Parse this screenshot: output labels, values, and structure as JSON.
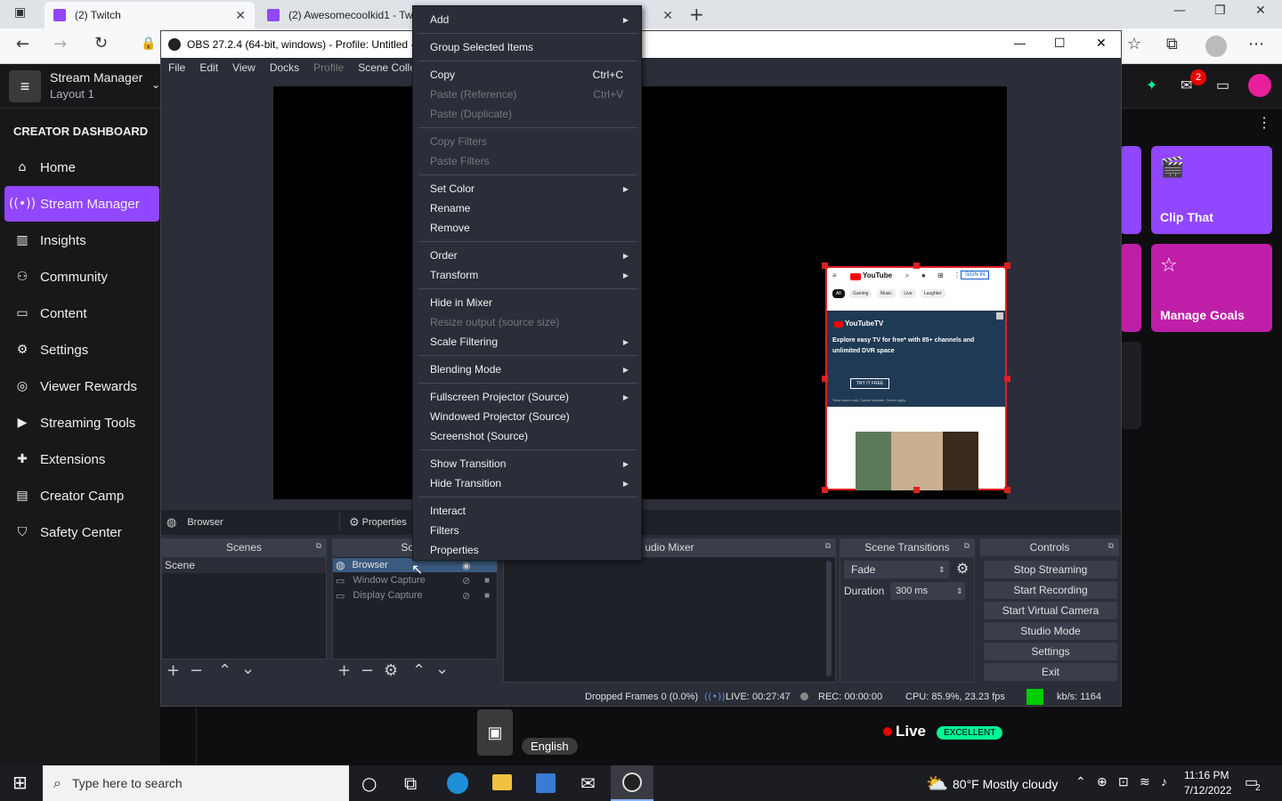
{
  "browser": {
    "tabs": [
      {
        "title": "(2) Twitch"
      },
      {
        "title": "(2) Awesomecoolkid1 - Tw"
      }
    ]
  },
  "twitch": {
    "header": {
      "title": "Stream Manager",
      "subtitle": "Layout 1",
      "notification_count": "2"
    },
    "sidebar": {
      "heading": "CREATOR DASHBOARD",
      "items": [
        {
          "label": "Home",
          "icon": "home-icon"
        },
        {
          "label": "Stream Manager",
          "icon": "broadcast-icon",
          "active": true
        },
        {
          "label": "Insights",
          "icon": "insights-icon"
        },
        {
          "label": "Community",
          "icon": "community-icon"
        },
        {
          "label": "Content",
          "icon": "content-icon"
        },
        {
          "label": "Settings",
          "icon": "gear-icon"
        },
        {
          "label": "Viewer Rewards",
          "icon": "rewards-icon"
        },
        {
          "label": "Streaming Tools",
          "icon": "camera-icon"
        },
        {
          "label": "Extensions",
          "icon": "puzzle-icon"
        },
        {
          "label": "Creator Camp",
          "icon": "book-icon"
        },
        {
          "label": "Safety Center",
          "icon": "shield-icon"
        }
      ]
    },
    "quick_actions": {
      "clip": "Clip That",
      "goals": "Manage Goals"
    },
    "bottom": {
      "language": "English",
      "live": "Live",
      "quality": "EXCELLENT"
    }
  },
  "obs": {
    "title": "OBS 27.2.4 (64-bit, windows) - Profile: Untitled -",
    "menu": [
      "File",
      "Edit",
      "View",
      "Docks",
      "Profile",
      "Scene Collec"
    ],
    "source_toolbar": {
      "source": "Browser",
      "properties": "Properties"
    },
    "docks": {
      "scenes": {
        "title": "Scenes",
        "items": [
          "Scene"
        ]
      },
      "sources": {
        "title": "Sourc",
        "items": [
          "Browser",
          "Window Capture",
          "Display Capture"
        ]
      },
      "mixer": {
        "title": "udio Mixer"
      },
      "transitions": {
        "title": "Scene Transitions",
        "transition": "Fade",
        "duration_label": "Duration",
        "duration": "300 ms"
      },
      "controls": {
        "title": "Controls",
        "buttons": [
          "Stop Streaming",
          "Start Recording",
          "Start Virtual Camera",
          "Studio Mode",
          "Settings",
          "Exit"
        ]
      }
    },
    "status": {
      "dropped": "Dropped Frames 0 (0.0%)",
      "live": "LIVE: 00:27:47",
      "rec": "REC: 00:00:00",
      "cpu": "CPU: 85.9%, 23.23 fps",
      "kbs": "kb/s: 1164"
    },
    "youtube": {
      "logo": "YouTube",
      "sign_in": "SIGN IN",
      "chips": [
        "All",
        "Gaming",
        "Music",
        "Live",
        "Laughter"
      ],
      "ad_brand": "YouTubeTV",
      "ad_text": "Explore easy TV for free* with 85+ channels and unlimited DVR space",
      "ad_button": "TRY IT FREE",
      "ad_fine": "*New users only. Cancel anytime. Terms apply"
    }
  },
  "context_menu": {
    "items": [
      {
        "label": "Add",
        "submenu": true
      },
      {
        "label": "Group Selected Items"
      },
      {
        "label": "Copy",
        "shortcut": "Ctrl+C"
      },
      {
        "label": "Paste (Reference)",
        "shortcut": "Ctrl+V",
        "disabled": true
      },
      {
        "label": "Paste (Duplicate)",
        "disabled": true
      },
      {
        "label": "Copy Filters",
        "disabled": true
      },
      {
        "label": "Paste Filters",
        "disabled": true
      },
      {
        "label": "Set Color",
        "submenu": true
      },
      {
        "label": "Rename"
      },
      {
        "label": "Remove"
      },
      {
        "label": "Order",
        "submenu": true
      },
      {
        "label": "Transform",
        "submenu": true
      },
      {
        "label": "Hide in Mixer"
      },
      {
        "label": "Resize output (source size)",
        "disabled": true
      },
      {
        "label": "Scale Filtering",
        "submenu": true
      },
      {
        "label": "Blending Mode",
        "submenu": true
      },
      {
        "label": "Fullscreen Projector (Source)",
        "submenu": true
      },
      {
        "label": "Windowed Projector (Source)"
      },
      {
        "label": "Screenshot (Source)"
      },
      {
        "label": "Show Transition",
        "submenu": true
      },
      {
        "label": "Hide Transition",
        "submenu": true
      },
      {
        "label": "Interact"
      },
      {
        "label": "Filters"
      },
      {
        "label": "Properties"
      }
    ]
  },
  "taskbar": {
    "search_placeholder": "Type here to search",
    "weather": "80°F  Mostly cloudy",
    "time": "11:16 PM",
    "date": "7/12/2022",
    "notifications": "2"
  }
}
